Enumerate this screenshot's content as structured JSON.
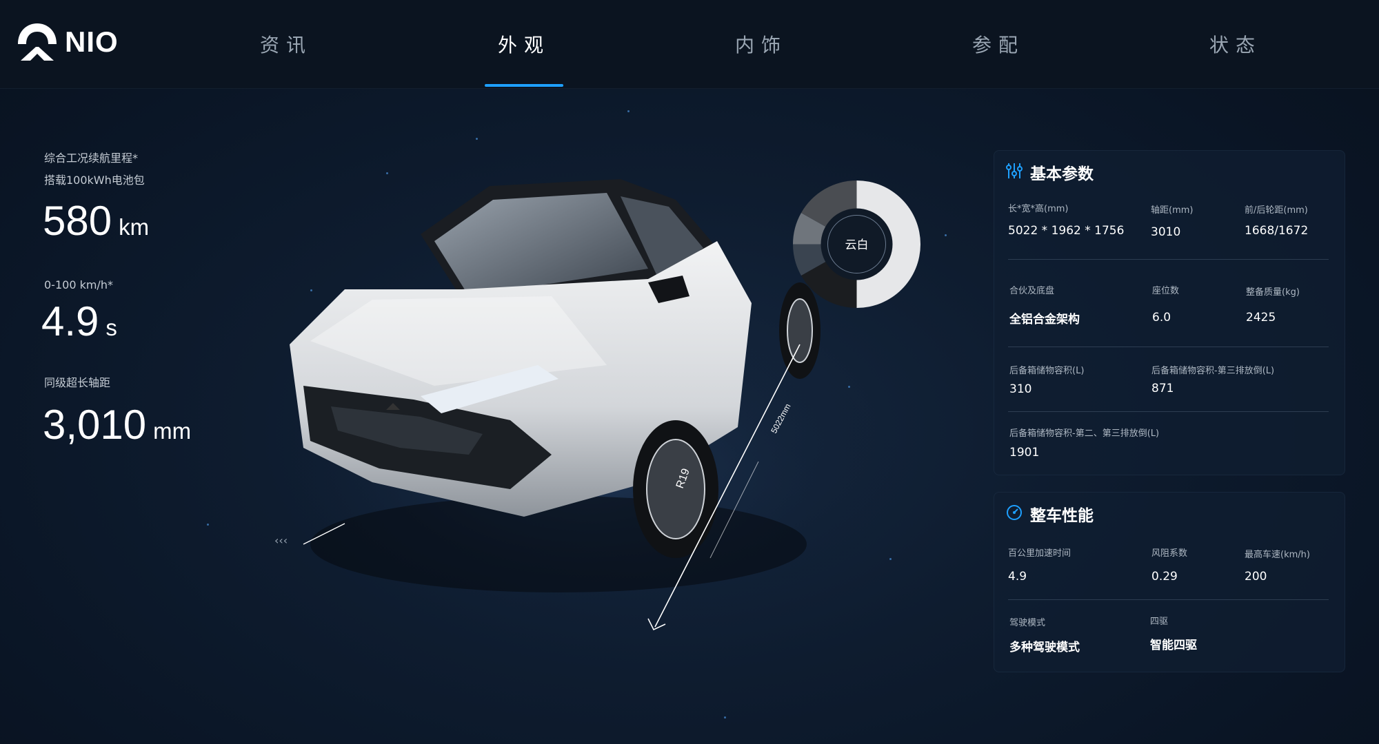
{
  "brand": {
    "name": "NIO",
    "logo_icon": "nio-logo"
  },
  "tabs": [
    {
      "label": "资讯",
      "active": false
    },
    {
      "label": "外观",
      "active": true
    },
    {
      "label": "内饰",
      "active": false
    },
    {
      "label": "参配",
      "active": false
    },
    {
      "label": "状态",
      "active": false
    }
  ],
  "stats": {
    "range": {
      "label_line1": "综合工况续航里程*",
      "label_line2": "搭载100kWh电池包",
      "value": "580",
      "unit": "km"
    },
    "accel": {
      "label": "0-100 km/h*",
      "value": "4.9",
      "unit": "s"
    },
    "wheelbase": {
      "label": "同级超长轴距",
      "value": "3,010",
      "unit": "mm"
    }
  },
  "car_view": {
    "color_wheel_label": "云白",
    "wheel_label": "R19",
    "dimension_label": "5022mm"
  },
  "basic_params": {
    "title": "基本参数",
    "icon": "sliders-icon",
    "rows": [
      [
        {
          "label": "长*宽*高(mm)",
          "value": "5022 * 1962 * 1756"
        },
        {
          "label": "轴距(mm)",
          "value": "3010"
        },
        {
          "label": "前/后轮距(mm)",
          "value": "1668/1672"
        }
      ],
      [
        {
          "label": "合伙及底盘",
          "value": "全铝合金架构"
        },
        {
          "label": "座位数",
          "value": "6.0"
        },
        {
          "label": "整备质量(kg)",
          "value": "2425"
        }
      ],
      [
        {
          "label": "后备箱储物容积(L)",
          "value": "310"
        },
        {
          "label": "后备箱储物容积-第三排放倒(L)",
          "value": "871"
        }
      ],
      [
        {
          "label": "后备箱储物容积-第二、第三排放倒(L)",
          "value": "1901"
        }
      ]
    ]
  },
  "performance": {
    "title": "整车性能",
    "icon": "speedometer-icon",
    "rows": [
      [
        {
          "label": "百公里加速时间",
          "value": "4.9"
        },
        {
          "label": "风阻系数",
          "value": "0.29"
        },
        {
          "label": "最高车速(km/h)",
          "value": "200"
        }
      ],
      [
        {
          "label": "驾驶模式",
          "value": "多种驾驶模式"
        },
        {
          "label": "四驱",
          "value": "智能四驱"
        }
      ]
    ]
  },
  "colors": {
    "accent": "#1ea0ff",
    "background": "#0e1c2f",
    "panel": "#101e31"
  }
}
